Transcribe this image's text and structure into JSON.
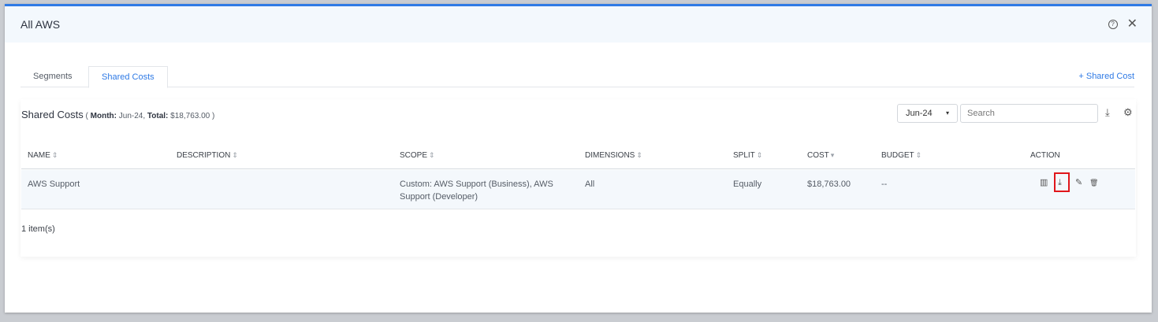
{
  "modal": {
    "title": "All AWS",
    "help_icon": "?",
    "close_icon": "✕"
  },
  "tabs": [
    {
      "label": "Segments",
      "active": false
    },
    {
      "label": "Shared Costs",
      "active": true
    }
  ],
  "add_shared_cost_label": "+ Shared Cost",
  "card": {
    "title": "Shared Costs",
    "meta_open": " ( ",
    "month_label": "Month:",
    "month_value": " Jun-24, ",
    "total_label": "Total:",
    "total_value": " $18,763.00 )"
  },
  "month_select": {
    "value": "Jun-24",
    "caret": "▾"
  },
  "search": {
    "placeholder": "Search",
    "value": ""
  },
  "toolbar_icons": {
    "download": "⤓",
    "settings": "⚙"
  },
  "table": {
    "columns": [
      "NAME",
      "DESCRIPTION",
      "SCOPE",
      "DIMENSIONS",
      "SPLIT",
      "COST",
      "BUDGET",
      "ACTION"
    ],
    "sort_icon": "⇕",
    "cost_sort_icon": "▾",
    "rows": [
      {
        "name": "AWS Support",
        "description": "",
        "scope": "Custom: AWS Support (Business), AWS Support (Developer)",
        "dimensions": "All",
        "split": "Equally",
        "cost": "$18,763.00",
        "budget": "--"
      }
    ],
    "action_icons": {
      "chart": "▥",
      "download": "⤓",
      "edit": "✎",
      "delete": "🗑"
    }
  },
  "items_count": "1 item(s)",
  "colors": {
    "accent": "#2f7ae5",
    "highlight": "#e0161b",
    "row_bg": "#f4f8fc",
    "header_bg": "#f3f8fd"
  }
}
